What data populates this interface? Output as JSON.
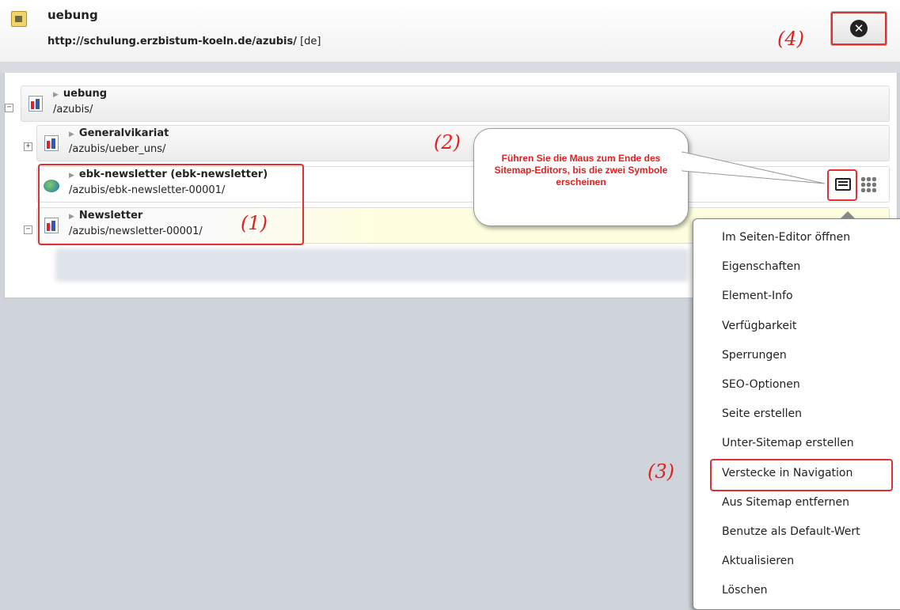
{
  "header": {
    "site_title": "uebung",
    "site_url": "http://schulung.erzbistum-koeln.de/azubis/",
    "lang": "[de]"
  },
  "tree": {
    "rows": [
      {
        "title": "uebung",
        "path": "/azubis/",
        "toggle": "−"
      },
      {
        "title": "Generalvikariat",
        "path": "/azubis/ueber_uns/",
        "toggle": "+"
      },
      {
        "title": "ebk-newsletter  (ebk-newsletter)",
        "path": "/azubis/ebk-newsletter-00001/"
      },
      {
        "title": "Newsletter",
        "path": "/azubis/newsletter-00001/",
        "toggle": "−"
      }
    ]
  },
  "annotations": {
    "a1": "(1)",
    "a2": "(2)",
    "a3": "(3)",
    "a4": "(4)"
  },
  "callout": {
    "text": "Führen Sie die Maus zum Ende des Sitemap-Editors, bis die zwei Symbole erscheinen"
  },
  "context_menu": {
    "items": [
      "Im Seiten-Editor öffnen",
      "Eigenschaften",
      "Element-Info",
      "Verfügbarkeit",
      "Sperrungen",
      "SEO-Optionen",
      "Seite erstellen",
      "Unter-Sitemap erstellen",
      "Verstecke in Navigation",
      "Aus Sitemap entfernen",
      "Benutze als Default-Wert",
      "Aktualisieren",
      "Löschen"
    ]
  },
  "colors": {
    "annotation_red": "#e02020",
    "highlight_row": "#ffffe0"
  }
}
